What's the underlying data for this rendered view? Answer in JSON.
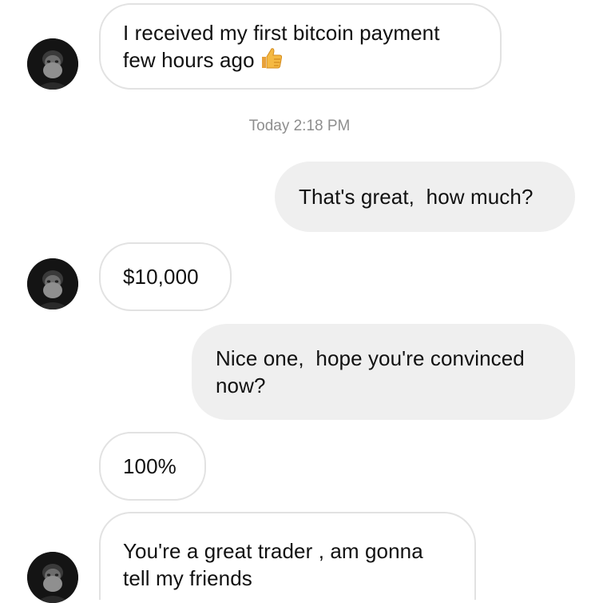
{
  "conversation": {
    "timestamp": "Today 2:18 PM",
    "messages": [
      {
        "sender": "incoming",
        "text_line1": "I received my first bitcoin payment",
        "text_line2": "few hours ago",
        "emoji": "thumbs-up"
      },
      {
        "sender": "outgoing",
        "text": "That's great,  how much?"
      },
      {
        "sender": "incoming",
        "text": "$10,000"
      },
      {
        "sender": "outgoing",
        "text_line1": "Nice one,  hope you're convinced",
        "text_line2": "now?"
      },
      {
        "sender": "incoming",
        "text": "100%"
      },
      {
        "sender": "incoming",
        "text_line1": "You're a great trader , am gonna",
        "text_line2": "tell my friends"
      }
    ]
  },
  "colors": {
    "outgoing_bubble": "#efefef",
    "incoming_border": "#e2e2e2",
    "timestamp_text": "#8e8e8e",
    "avatar_bg": "#1a1a1a"
  }
}
